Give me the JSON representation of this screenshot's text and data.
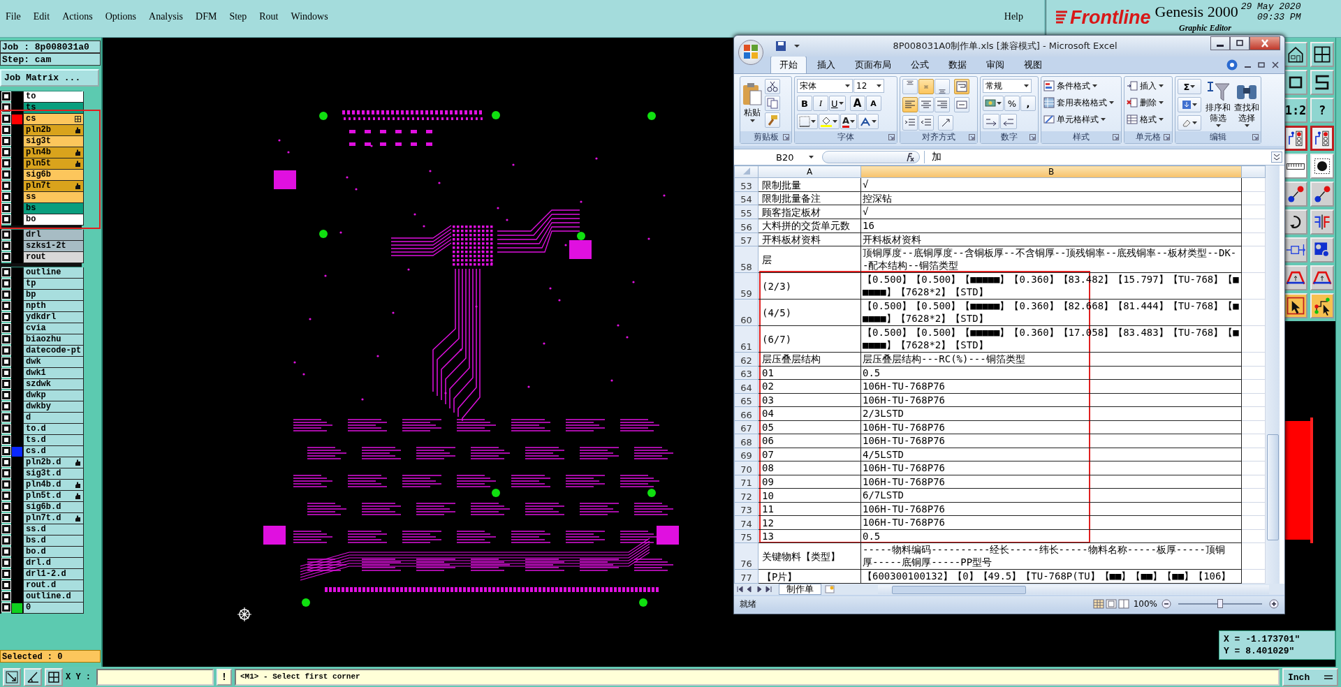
{
  "menu": [
    "File",
    "Edit",
    "Actions",
    "Options",
    "Analysis",
    "DFM",
    "Step",
    "Rout",
    "Windows"
  ],
  "help": "Help",
  "brand": {
    "logo": "Frontline",
    "product": "Genesis 2000",
    "date": "29 May 2020",
    "time": "09:33 PM",
    "subtitle": "Graphic Editor"
  },
  "job": {
    "job": "Job : 8p008031a0",
    "step": "Step: cam",
    "matrix_button": "Job Matrix ..."
  },
  "layer_groups": [
    [
      {
        "name": "to",
        "kind": "silk",
        "checked": false,
        "flagged": false
      },
      {
        "name": "ts",
        "kind": "mask",
        "checked": false,
        "flagged": false
      },
      {
        "name": "cs",
        "kind": "signal",
        "checked": false,
        "flagged": false,
        "active": true,
        "color": "#ff0000"
      },
      {
        "name": "pln2b",
        "kind": "plane",
        "checked": false,
        "flagged": true
      },
      {
        "name": "sig3t",
        "kind": "signal",
        "checked": false,
        "flagged": false
      },
      {
        "name": "pln4b",
        "kind": "plane",
        "checked": false,
        "flagged": true
      },
      {
        "name": "pln5t",
        "kind": "plane",
        "checked": false,
        "flagged": true
      },
      {
        "name": "sig6b",
        "kind": "signal",
        "checked": false,
        "flagged": false
      },
      {
        "name": "pln7t",
        "kind": "plane",
        "checked": false,
        "flagged": true
      },
      {
        "name": "ss",
        "kind": "signal",
        "checked": false,
        "flagged": false
      },
      {
        "name": "bs",
        "kind": "mask",
        "checked": false,
        "flagged": false
      },
      {
        "name": "bo",
        "kind": "silk",
        "checked": false,
        "flagged": false
      }
    ],
    [
      {
        "name": "drl",
        "kind": "drill",
        "checked": false,
        "flagged": false
      },
      {
        "name": "szks1-2t",
        "kind": "drill",
        "checked": false,
        "flagged": false
      },
      {
        "name": "rout",
        "kind": "rout",
        "checked": false,
        "flagged": false
      }
    ],
    [
      {
        "name": "outline",
        "kind": "misc",
        "checked": false,
        "flagged": false
      },
      {
        "name": "tp",
        "kind": "misc",
        "checked": false,
        "flagged": false
      },
      {
        "name": "bp",
        "kind": "misc",
        "checked": false,
        "flagged": false
      },
      {
        "name": "npth",
        "kind": "misc",
        "checked": false,
        "flagged": false
      },
      {
        "name": "ydkdrl",
        "kind": "misc",
        "checked": false,
        "flagged": false
      },
      {
        "name": "cvia",
        "kind": "misc",
        "checked": false,
        "flagged": false
      },
      {
        "name": "biaozhu",
        "kind": "misc",
        "checked": false,
        "flagged": false
      },
      {
        "name": "datecode-pt",
        "kind": "misc",
        "checked": false,
        "flagged": false
      },
      {
        "name": "dwk",
        "kind": "misc",
        "checked": false,
        "flagged": false
      },
      {
        "name": "dwk1",
        "kind": "misc",
        "checked": false,
        "flagged": false
      },
      {
        "name": "szdwk",
        "kind": "misc",
        "checked": false,
        "flagged": false
      },
      {
        "name": "dwkp",
        "kind": "misc",
        "checked": false,
        "flagged": false
      },
      {
        "name": "dwkby",
        "kind": "misc",
        "checked": false,
        "flagged": false
      },
      {
        "name": "d",
        "kind": "misc",
        "checked": false,
        "flagged": false
      },
      {
        "name": "to.d",
        "kind": "misc",
        "checked": false,
        "flagged": false
      },
      {
        "name": "ts.d",
        "kind": "misc",
        "checked": false,
        "flagged": false
      },
      {
        "name": "cs.d",
        "kind": "misc",
        "checked": false,
        "flagged": false,
        "color": "#0a28ff"
      },
      {
        "name": "pln2b.d",
        "kind": "misc",
        "checked": false,
        "flagged": true
      },
      {
        "name": "sig3t.d",
        "kind": "misc",
        "checked": false,
        "flagged": false
      },
      {
        "name": "pln4b.d",
        "kind": "misc",
        "checked": false,
        "flagged": true
      },
      {
        "name": "pln5t.d",
        "kind": "misc",
        "checked": false,
        "flagged": true
      },
      {
        "name": "sig6b.d",
        "kind": "misc",
        "checked": false,
        "flagged": false
      },
      {
        "name": "pln7t.d",
        "kind": "misc",
        "checked": false,
        "flagged": true
      },
      {
        "name": "ss.d",
        "kind": "misc",
        "checked": false,
        "flagged": false
      },
      {
        "name": "bs.d",
        "kind": "misc",
        "checked": false,
        "flagged": false
      },
      {
        "name": "bo.d",
        "kind": "misc",
        "checked": false,
        "flagged": false
      },
      {
        "name": "drl.d",
        "kind": "misc",
        "checked": false,
        "flagged": false
      },
      {
        "name": "drl1-2.d",
        "kind": "misc",
        "checked": false,
        "flagged": false
      },
      {
        "name": "rout.d",
        "kind": "misc",
        "checked": false,
        "flagged": false
      },
      {
        "name": "outline.d",
        "kind": "misc",
        "checked": false,
        "flagged": false
      },
      {
        "name": "0",
        "kind": "misc",
        "checked": false,
        "flagged": false,
        "color": "#10d020"
      }
    ]
  ],
  "selected_count": "Selected : 0",
  "toolbar": [
    {
      "kind": "house"
    },
    {
      "kind": "window"
    },
    {
      "kind": "rect"
    },
    {
      "kind": "zigzag"
    },
    {
      "kind": "ratio",
      "label": "1:2"
    },
    {
      "kind": "help",
      "label": "?"
    },
    {
      "kind": "net"
    },
    {
      "kind": "net"
    },
    {
      "kind": "ruler"
    },
    {
      "kind": "pad"
    },
    {
      "kind": "link"
    },
    {
      "kind": "link"
    },
    {
      "kind": "rotate"
    },
    {
      "kind": "mirror"
    },
    {
      "kind": "probe"
    },
    {
      "kind": "shapes"
    },
    {
      "kind": "arc"
    },
    {
      "kind": "arc"
    },
    {
      "kind": "select"
    },
    {
      "kind": "route"
    }
  ],
  "excel": {
    "title": "8P008031A0制作单.xls  [兼容模式] - Microsoft Excel",
    "tabs": [
      {
        "label": "开始",
        "selected": true
      },
      {
        "label": "插入",
        "selected": false
      },
      {
        "label": "页面布局",
        "selected": false
      },
      {
        "label": "公式",
        "selected": false
      },
      {
        "label": "数据",
        "selected": false
      },
      {
        "label": "审阅",
        "selected": false
      },
      {
        "label": "视图",
        "selected": false
      }
    ],
    "ribbon": [
      {
        "kind": "clipboard",
        "label": "剪贴板",
        "paste": "粘贴"
      },
      {
        "kind": "font",
        "label": "字体",
        "font": "宋体",
        "size": "12",
        "bold": "B",
        "italic": "I",
        "underline": "U",
        "grow": "A",
        "shrink": "A",
        "font_color": "A"
      },
      {
        "kind": "alignment",
        "label": "对齐方式",
        "buttons": [
          {
            "selected": false
          },
          {
            "selected": true
          },
          {
            "selected": false
          },
          {
            "selected": true
          },
          {
            "selected": true
          },
          {
            "selected": false
          },
          {
            "selected": false
          },
          {
            "selected": false
          },
          {
            "selected": false
          },
          {
            "selected": false
          },
          {
            "selected": false
          }
        ]
      },
      {
        "kind": "number",
        "label": "数字",
        "format": "常规",
        "percent": "%",
        "comma": ","
      },
      {
        "kind": "styles",
        "label": "样式",
        "items": [
          "条件格式",
          "套用表格格式",
          "单元格样式"
        ]
      },
      {
        "kind": "cells",
        "label": "单元格",
        "items": [
          "插入",
          "删除",
          "格式"
        ]
      },
      {
        "kind": "editing",
        "label": "编辑",
        "sum": "Σ",
        "items": [
          "排序和筛选",
          "查找和选择"
        ]
      }
    ],
    "name_box": "B20",
    "formula": "加",
    "columns": [
      "A",
      "B"
    ],
    "rows": [
      {
        "row": "53",
        "a": "限制批量",
        "b": "√"
      },
      {
        "row": "54",
        "a": "限制批量备注",
        "b": "控深钻"
      },
      {
        "row": "55",
        "a": "顾客指定板材",
        "b": "√"
      },
      {
        "row": "56",
        "a": "大料拼的交货单元数",
        "b": "16"
      },
      {
        "row": "57",
        "a": "开料板材资料",
        "b": "开料板材资料"
      },
      {
        "row": "58",
        "a": "层",
        "b": "顶铜厚度--底铜厚度--含铜板厚--不含铜厚--顶残铜率--底残铜率--板材类型--DK--配本结构--铜箔类型"
      },
      {
        "row": "59",
        "a": "(2/3)",
        "b": "【0.500】【0.500】【■■■■■】【0.360】【83.482】【15.797】【TU-768】【■■■■■】【7628*2】【STD】"
      },
      {
        "row": "60",
        "a": "(4/5)",
        "b": "【0.500】【0.500】【■■■■■】【0.360】【82.668】【81.444】【TU-768】【■■■■■】【7628*2】【STD】"
      },
      {
        "row": "61",
        "a": "(6/7)",
        "b": "【0.500】【0.500】【■■■■■】【0.360】【17.058】【83.483】【TU-768】【■■■■■】【7628*2】【STD】"
      },
      {
        "row": "62",
        "a": "层压叠层结构",
        "b": "层压叠层结构---RC(%)---铜箔类型"
      },
      {
        "row": "63",
        "a": "01",
        "b": "0.5"
      },
      {
        "row": "64",
        "a": "02",
        "b": "106H-TU-768P76"
      },
      {
        "row": "65",
        "a": "03",
        "b": "106H-TU-768P76"
      },
      {
        "row": "66",
        "a": "04",
        "b": "2/3LSTD"
      },
      {
        "row": "67",
        "a": "05",
        "b": "106H-TU-768P76"
      },
      {
        "row": "68",
        "a": "06",
        "b": "106H-TU-768P76"
      },
      {
        "row": "69",
        "a": "07",
        "b": "4/5LSTD"
      },
      {
        "row": "70",
        "a": "08",
        "b": "106H-TU-768P76"
      },
      {
        "row": "71",
        "a": "09",
        "b": "106H-TU-768P76"
      },
      {
        "row": "72",
        "a": "10",
        "b": "6/7LSTD"
      },
      {
        "row": "73",
        "a": "11",
        "b": "106H-TU-768P76"
      },
      {
        "row": "74",
        "a": "12",
        "b": "106H-TU-768P76"
      },
      {
        "row": "75",
        "a": "13",
        "b": "0.5"
      },
      {
        "row": "76",
        "a": "关键物料【类型】",
        "b": "-----物料编码----------经长-----纬长-----物料名称-----板厚-----顶铜厚-----底铜厚-----PP型号"
      },
      {
        "row": "77",
        "a": "【P片】",
        "b": "【600300100132】【0】【49.5】【TU-768P(TU】【■■】【■■】【■■】【106】"
      }
    ],
    "sheet_tab": "制作单",
    "status": "就绪",
    "zoom": "100%",
    "zoom_level": {
      "level": 0.5
    }
  },
  "coordinates": {
    "x": "X = -1.173701\"",
    "y": "Y = 8.401029\""
  },
  "bottom_bar": {
    "xy_label": "X Y :",
    "alert": "!",
    "message": "<M1> - Select first corner",
    "units": "Inch"
  }
}
